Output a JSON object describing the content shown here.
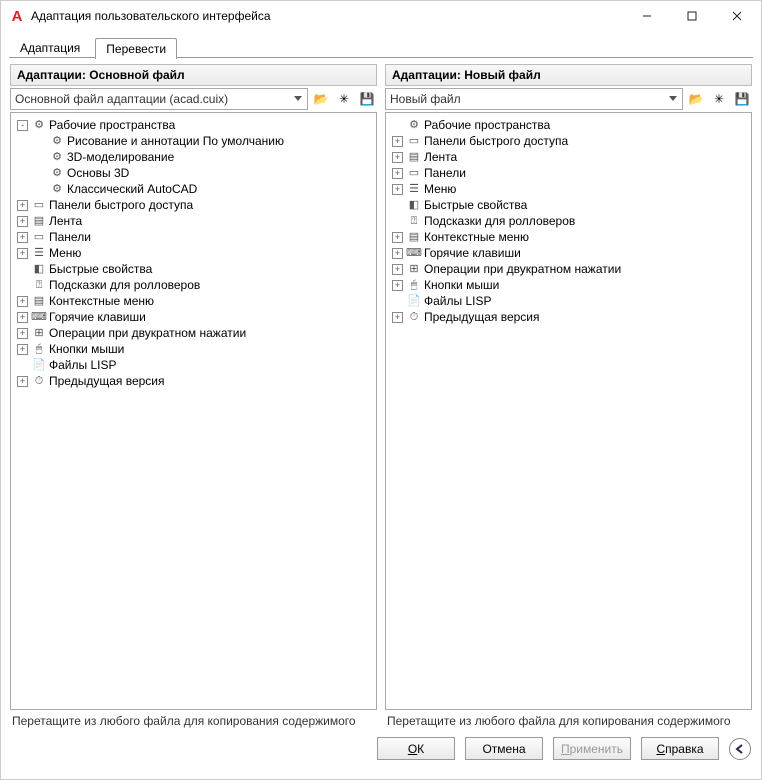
{
  "window": {
    "title": "Адаптация пользовательского интерфейса"
  },
  "tabs": {
    "adapt": "Адаптация",
    "translate": "Перевести"
  },
  "left": {
    "panel_title": "Адаптации: Основной файл",
    "combo": "Основной файл адаптации (acad.cuix)",
    "hint": "Перетащите из любого файла для копирования содержимого",
    "tree": [
      {
        "indent": 0,
        "expander": "-",
        "icon": "workspace",
        "label": "Рабочие пространства"
      },
      {
        "indent": 1,
        "expander": "",
        "icon": "workspace",
        "label": "Рисование и аннотации По умолчанию"
      },
      {
        "indent": 1,
        "expander": "",
        "icon": "workspace",
        "label": "3D-моделирование"
      },
      {
        "indent": 1,
        "expander": "",
        "icon": "workspace",
        "label": "Основы 3D"
      },
      {
        "indent": 1,
        "expander": "",
        "icon": "workspace",
        "label": "Классический AutoCAD"
      },
      {
        "indent": 0,
        "expander": "+",
        "icon": "panel",
        "label": "Панели быстрого доступа"
      },
      {
        "indent": 0,
        "expander": "+",
        "icon": "ribbon",
        "label": "Лента"
      },
      {
        "indent": 0,
        "expander": "+",
        "icon": "panel",
        "label": "Панели"
      },
      {
        "indent": 0,
        "expander": "+",
        "icon": "menu",
        "label": "Меню"
      },
      {
        "indent": 0,
        "expander": "",
        "icon": "prop",
        "label": "Быстрые свойства"
      },
      {
        "indent": 0,
        "expander": "",
        "icon": "tooltip",
        "label": "Подсказки для ролловеров"
      },
      {
        "indent": 0,
        "expander": "+",
        "icon": "context",
        "label": "Контекстные меню"
      },
      {
        "indent": 0,
        "expander": "+",
        "icon": "hotkey",
        "label": "Горячие клавиши"
      },
      {
        "indent": 0,
        "expander": "+",
        "icon": "dblclick",
        "label": "Операции при двукратном нажатии"
      },
      {
        "indent": 0,
        "expander": "+",
        "icon": "mouse",
        "label": "Кнопки мыши"
      },
      {
        "indent": 0,
        "expander": "",
        "icon": "lisp",
        "label": "Файлы LISP"
      },
      {
        "indent": 0,
        "expander": "+",
        "icon": "prev",
        "label": "Предыдущая версия"
      }
    ]
  },
  "right": {
    "panel_title": "Адаптации: Новый файл",
    "combo": "Новый файл",
    "hint": "Перетащите из любого файла для копирования содержимого",
    "tree": [
      {
        "indent": 0,
        "expander": "",
        "icon": "workspace",
        "label": "Рабочие пространства"
      },
      {
        "indent": 0,
        "expander": "+",
        "icon": "panel",
        "label": "Панели быстрого доступа"
      },
      {
        "indent": 0,
        "expander": "+",
        "icon": "ribbon",
        "label": "Лента"
      },
      {
        "indent": 0,
        "expander": "+",
        "icon": "panel",
        "label": "Панели"
      },
      {
        "indent": 0,
        "expander": "+",
        "icon": "menu",
        "label": "Меню"
      },
      {
        "indent": 0,
        "expander": "",
        "icon": "prop",
        "label": "Быстрые свойства"
      },
      {
        "indent": 0,
        "expander": "",
        "icon": "tooltip",
        "label": "Подсказки для ролловеров"
      },
      {
        "indent": 0,
        "expander": "+",
        "icon": "context",
        "label": "Контекстные меню"
      },
      {
        "indent": 0,
        "expander": "+",
        "icon": "hotkey",
        "label": "Горячие клавиши"
      },
      {
        "indent": 0,
        "expander": "+",
        "icon": "dblclick",
        "label": "Операции при двукратном нажатии"
      },
      {
        "indent": 0,
        "expander": "+",
        "icon": "mouse",
        "label": "Кнопки мыши"
      },
      {
        "indent": 0,
        "expander": "",
        "icon": "lisp",
        "label": "Файлы LISP"
      },
      {
        "indent": 0,
        "expander": "+",
        "icon": "prev",
        "label": "Предыдущая версия"
      }
    ]
  },
  "buttons": {
    "ok": "ОК",
    "cancel": "Отмена",
    "apply": "Применить",
    "help": "Справка"
  },
  "icons": {
    "workspace": "⚙",
    "panel": "▭",
    "ribbon": "▤",
    "menu": "☰",
    "prop": "◧",
    "tooltip": "⍰",
    "context": "▤",
    "hotkey": "⌨",
    "dblclick": "⊞",
    "mouse": "🖱",
    "lisp": "📄",
    "prev": "⏱",
    "open_folder": "📂",
    "new_star": "✳",
    "save": "💾"
  }
}
